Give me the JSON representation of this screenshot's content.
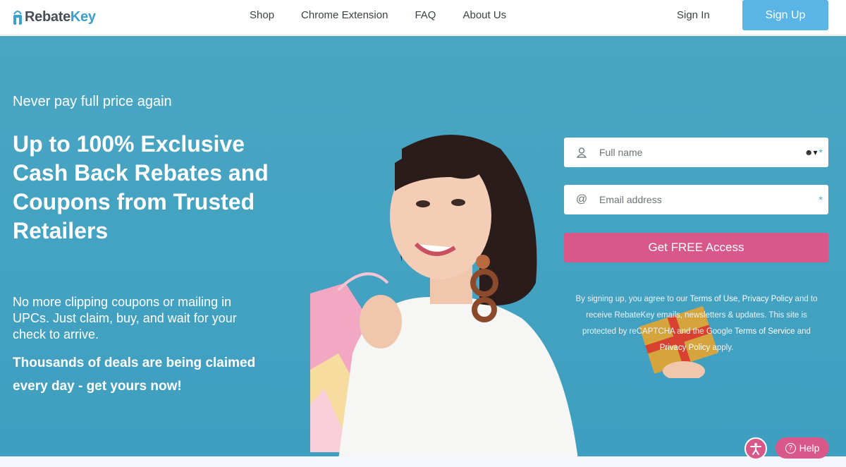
{
  "header": {
    "logo": {
      "part1": "Rebate",
      "part2": "Key"
    },
    "nav": [
      "Shop",
      "Chrome Extension",
      "FAQ",
      "About Us"
    ],
    "sign_in": "Sign In",
    "sign_up": "Sign Up"
  },
  "hero": {
    "tagline": "Never pay full price again",
    "headline": "Up to 100% Exclusive Cash Back Rebates and Coupons from Trusted Retailers",
    "body": "No more clipping coupons or mailing in UPCs. Just claim, buy, and wait for your check to arrive.",
    "body_bold": "Thousands of deals are being claimed every day - get yours now!"
  },
  "form": {
    "name_placeholder": "Full name",
    "email_placeholder": "Email address",
    "required_mark": "*",
    "cta": "Get FREE Access",
    "legal": {
      "t1": "By signing up, you agree to our ",
      "terms_of_use": "Terms of Use",
      "t2": ", ",
      "privacy_policy": "Privacy Policy",
      "t3": " and to receive RebateKey emails, newsletters & updates. This site is protected by reCAPTCHA and the Google ",
      "terms_of_service": "Terms of Service",
      "t4": " and ",
      "privacy_policy_2": "Privacy Policy",
      "t5": " apply."
    }
  },
  "widgets": {
    "help": "Help",
    "help_icon": "question-circle-icon",
    "accessibility_icon": "accessibility-person-icon"
  },
  "colors": {
    "brand_blue": "#3aa0cf",
    "signup_bg": "#5ab4e6",
    "hero_bg": "#45a3c2",
    "cta_pink": "#d9588a"
  }
}
